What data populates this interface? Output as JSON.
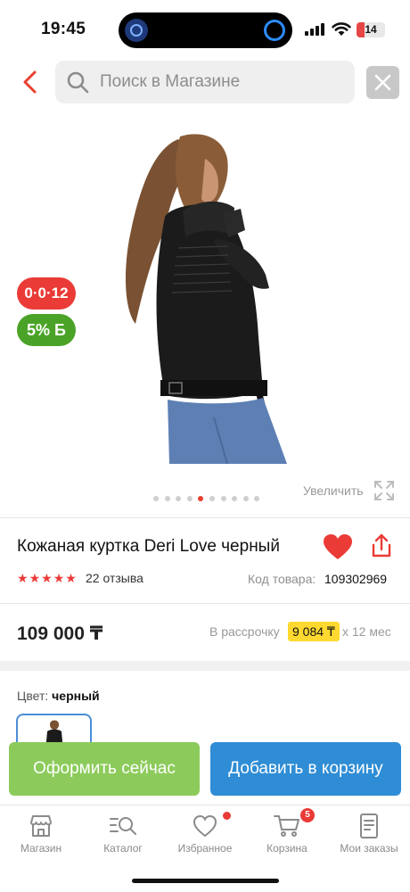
{
  "status": {
    "time": "19:45",
    "battery": "14"
  },
  "search": {
    "placeholder": "Поиск в Магазине"
  },
  "badges": {
    "timer": "0·0·12",
    "bonus": "5% Б"
  },
  "gallery": {
    "zoom_label": "Увеличить",
    "dot_count": 10,
    "active_index": 4
  },
  "product": {
    "title": "Кожаная куртка Deri Love черный",
    "rating": 5,
    "reviews": "22 отзыва",
    "code_label": "Код товара:",
    "code": "109302969",
    "price": "109 000 ₸",
    "installment_label": "В рассрочку",
    "installment_value": "9 084 ₸",
    "installment_term": "х 12 мес",
    "color_label": "Цвет:",
    "color_value": "черный"
  },
  "actions": {
    "buy_now": "Оформить сейчас",
    "add_to_cart": "Добавить в корзину"
  },
  "tabs": [
    {
      "label": "Магазин",
      "icon": "store-icon"
    },
    {
      "label": "Каталог",
      "icon": "catalog-search-icon"
    },
    {
      "label": "Избранное",
      "icon": "heart-icon"
    },
    {
      "label": "Корзина",
      "icon": "cart-icon",
      "badge": "5"
    },
    {
      "label": "Мои заказы",
      "icon": "orders-icon"
    }
  ],
  "colors": {
    "accent_red": "#ea3b36",
    "green": "#8ccb5b",
    "blue": "#2f8dd5",
    "installment_highlight": "#ffd92f"
  }
}
